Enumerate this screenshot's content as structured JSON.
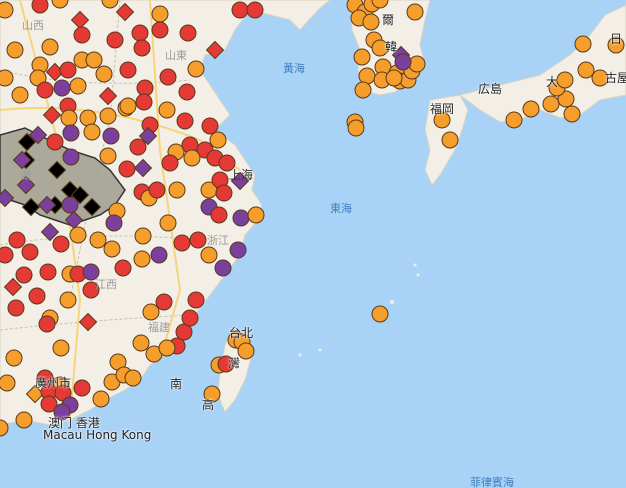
{
  "colors": {
    "sea": "#a9d2f7",
    "land": "#f3efe6",
    "highway": "#f5d57a",
    "orange": "#f59e2b",
    "red": "#e53935",
    "purple": "#7b3f9e",
    "black": "#000000",
    "highlight_region": "#9e9e8c"
  },
  "labels": {
    "yellow_sea": "黃海",
    "east_sea": "東海",
    "philippine_sea": "菲律賓海",
    "shanxi": "山西",
    "shandong": "山東",
    "shanghai": "上海",
    "zhejiang": "浙江",
    "jiangxi": "江西",
    "fujian": "福建",
    "hubei": "湖",
    "taipei": "台北",
    "taiwan": "灣",
    "kaohsiung": "高",
    "fuzhou_north": "南",
    "macau_hk_zh": "澳门  香港",
    "macau_hk_en": "Macau Hong Kong",
    "guangzhou": "廣州市",
    "korea": "韓",
    "seoul": "爾",
    "hiroshima": "広島",
    "fukuoka": "福岡",
    "osaka": "大",
    "nagoya": "古屋",
    "japan": "日"
  }
}
